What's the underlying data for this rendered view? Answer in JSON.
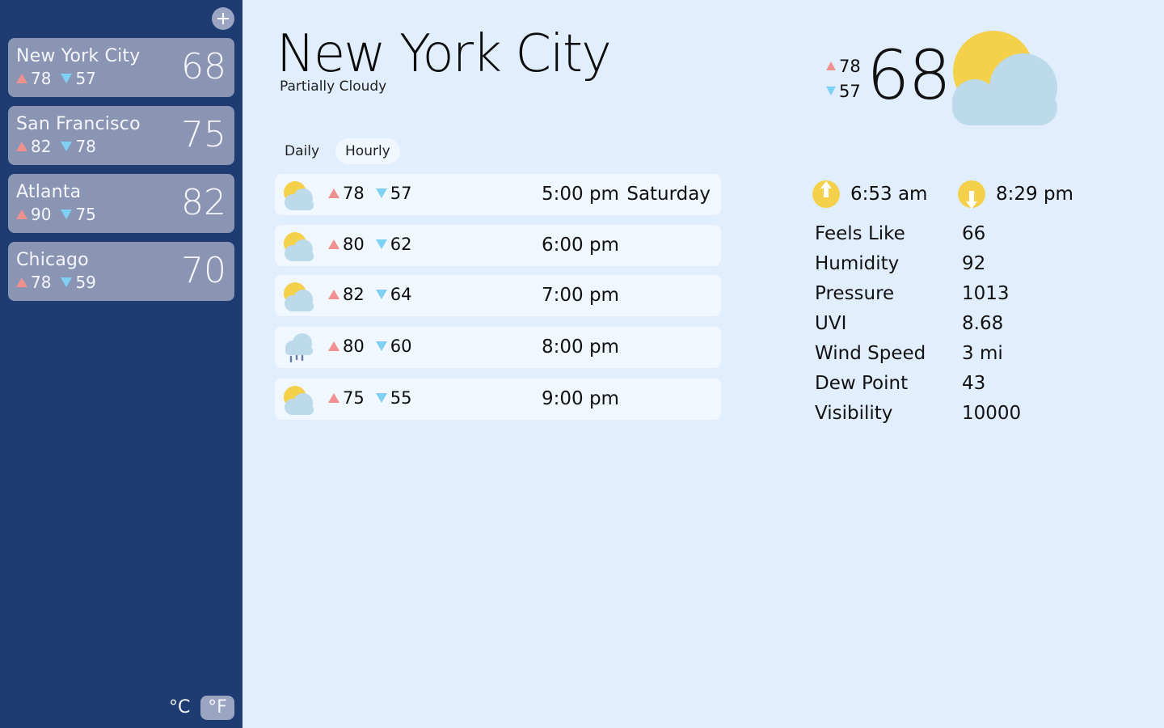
{
  "sidebar": {
    "add_label": "+",
    "cities": [
      {
        "name": "New York City",
        "high": "78",
        "low": "57",
        "temp": "68"
      },
      {
        "name": "San Francisco",
        "high": "82",
        "low": "78",
        "temp": "75"
      },
      {
        "name": "Atlanta",
        "high": "90",
        "low": "75",
        "temp": "82"
      },
      {
        "name": "Chicago",
        "high": "78",
        "low": "59",
        "temp": "70"
      }
    ],
    "unit_c": "°C",
    "unit_f": "°F",
    "selected_unit": "°F"
  },
  "header": {
    "city": "New York City",
    "condition": "Partially Cloudy"
  },
  "tabs": [
    {
      "label": "Daily",
      "active": false
    },
    {
      "label": "Hourly",
      "active": true
    }
  ],
  "hourly": [
    {
      "icon": "partly-cloudy-icon",
      "high": "78",
      "low": "57",
      "time": "5:00 pm",
      "day": "Saturday"
    },
    {
      "icon": "partly-cloudy-icon",
      "high": "80",
      "low": "62",
      "time": "6:00 pm",
      "day": ""
    },
    {
      "icon": "partly-cloudy-icon",
      "high": "82",
      "low": "64",
      "time": "7:00 pm",
      "day": ""
    },
    {
      "icon": "rain-cloud-icon",
      "high": "80",
      "low": "60",
      "time": "8:00 pm",
      "day": ""
    },
    {
      "icon": "partly-cloudy-icon",
      "high": "75",
      "low": "55",
      "time": "9:00 pm",
      "day": ""
    }
  ],
  "current": {
    "high": "78",
    "low": "57",
    "temp": "68",
    "icon": "partly-cloudy-icon"
  },
  "sun": {
    "sunrise": "6:53 am",
    "sunset": "8:29 pm"
  },
  "details": [
    {
      "label": "Feels Like",
      "value": "66"
    },
    {
      "label": "Humidity",
      "value": "92"
    },
    {
      "label": "Pressure",
      "value": "1013"
    },
    {
      "label": "UVI",
      "value": "8.68"
    },
    {
      "label": "Wind Speed",
      "value": "3 mi"
    },
    {
      "label": "Dew Point",
      "value": "43"
    },
    {
      "label": "Visibility",
      "value": "10000"
    }
  ],
  "colors": {
    "sidebar_bg": "#1e3c72",
    "card_bg": "#8995b2",
    "main_bg": "#e1eefd",
    "row_bg": "#f1f7fe",
    "high_arrow": "#f0908f",
    "low_arrow": "#7fd0f5",
    "sun": "#f5d04a",
    "cloud": "#bcdaea"
  }
}
